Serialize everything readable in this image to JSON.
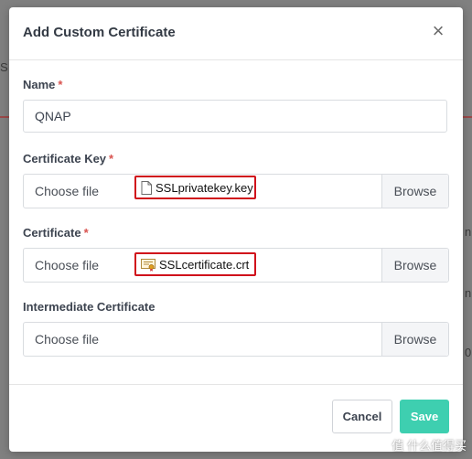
{
  "dialog": {
    "title": "Add Custom Certificate",
    "close_glyph": "×"
  },
  "fields": {
    "name": {
      "label": "Name",
      "required_mark": "*",
      "value": "QNAP"
    },
    "certificate_key": {
      "label": "Certificate Key",
      "required_mark": "*",
      "placeholder": "Choose file",
      "browse_label": "Browse",
      "selected_file": "SSLprivatekey.key",
      "file_icon": "document-icon"
    },
    "certificate": {
      "label": "Certificate",
      "required_mark": "*",
      "placeholder": "Choose file",
      "browse_label": "Browse",
      "selected_file": "SSLcertificate.crt",
      "file_icon": "certificate-icon"
    },
    "intermediate_certificate": {
      "label": "Intermediate Certificate",
      "placeholder": "Choose file",
      "browse_label": "Browse"
    }
  },
  "footer": {
    "cancel_label": "Cancel",
    "save_label": "Save"
  },
  "background": {
    "fragments": [
      "S",
      "n",
      "n",
      "0"
    ]
  },
  "watermark": {
    "text": "值 什么值得买"
  },
  "colors": {
    "accent": "#3ecfb0",
    "required": "#d9534f",
    "highlight_border": "#d0111b"
  }
}
